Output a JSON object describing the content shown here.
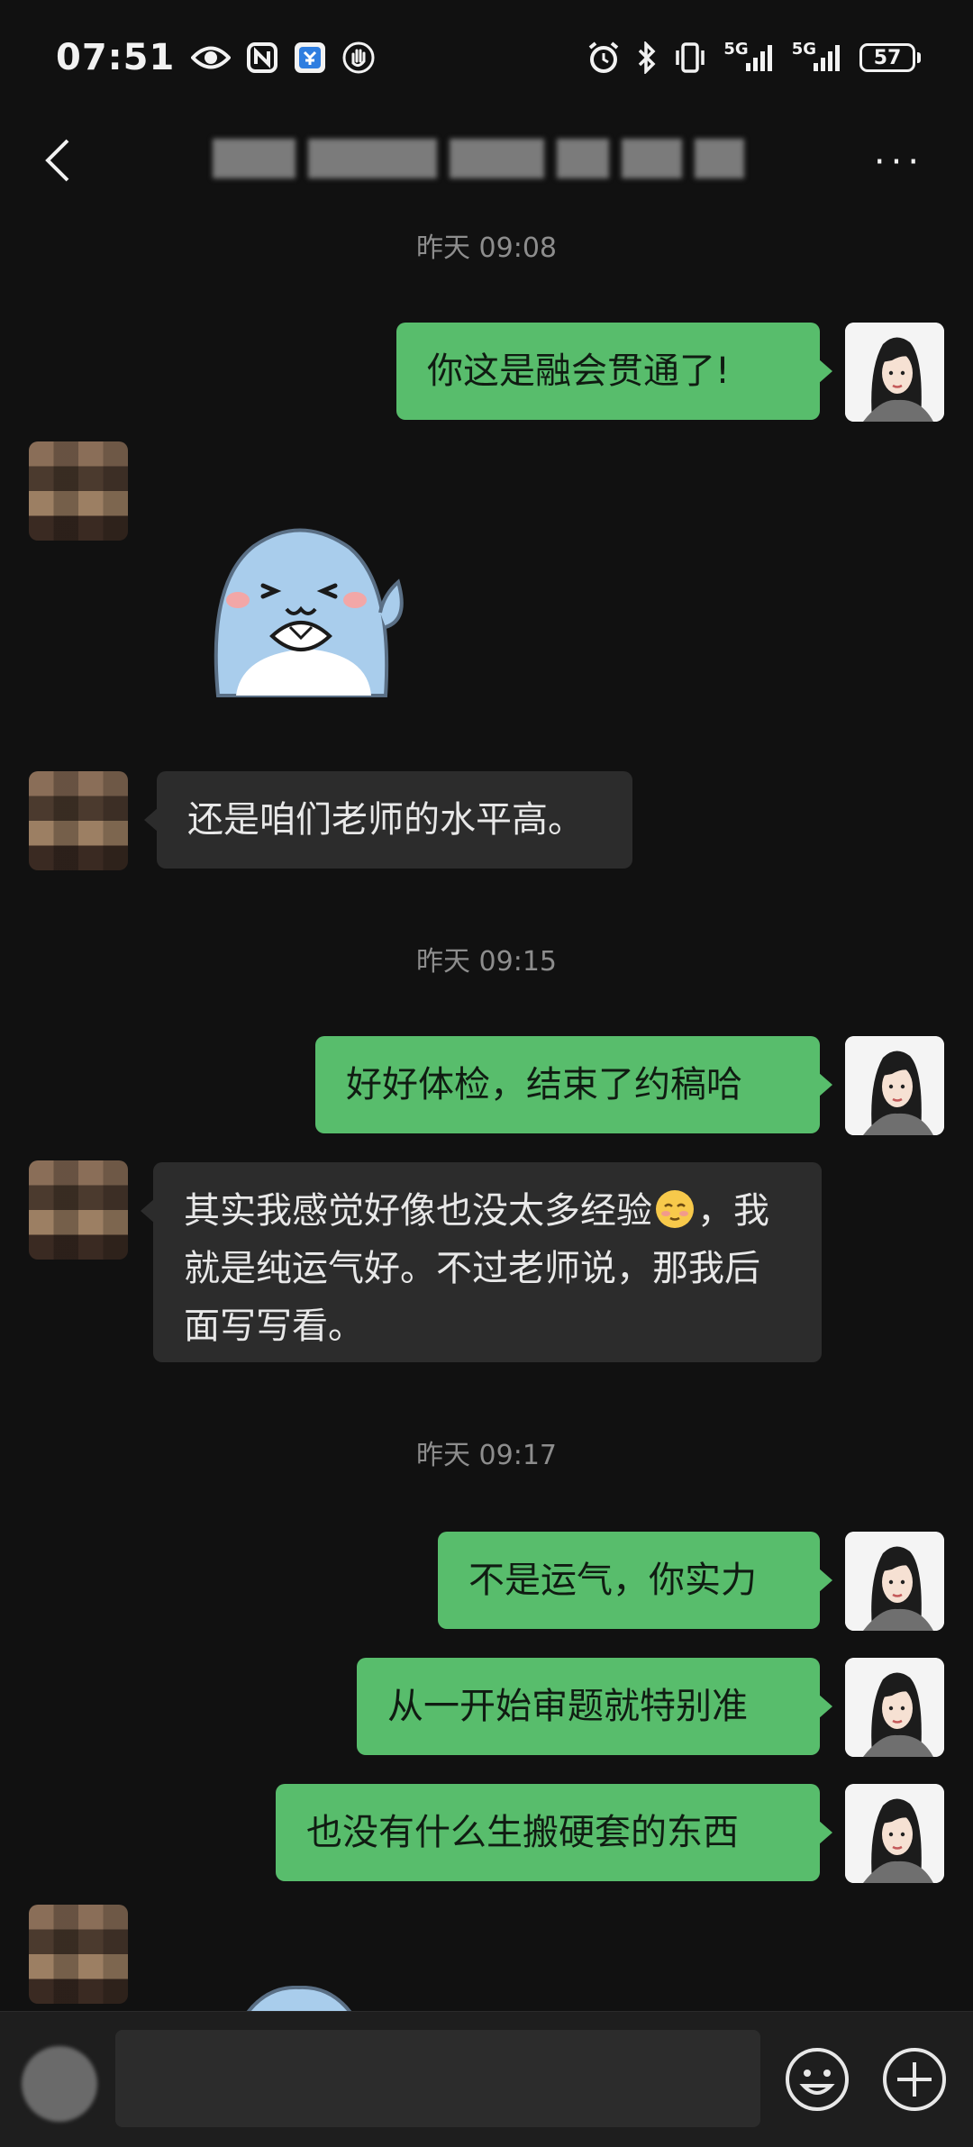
{
  "status_bar": {
    "time": "07:51",
    "battery": "57",
    "network_1": "5G",
    "network_2": "5G",
    "icons": [
      "eye-icon",
      "nfc-icon",
      "app-notification-icon",
      "hand-icon",
      "alarm-icon",
      "bluetooth-icon",
      "vibrate-icon",
      "signal-icon",
      "signal-icon",
      "battery-icon"
    ]
  },
  "header": {
    "back_icon": "chevron-left-icon",
    "more_label": "···"
  },
  "timestamps": [
    "昨天 09:08",
    "昨天 09:15",
    "昨天 09:17"
  ],
  "messages": [
    {
      "from": "self",
      "text": "你这是融会贯通了!"
    },
    {
      "from": "other",
      "type": "sticker",
      "sticker": "blue-dolphin-sticker"
    },
    {
      "from": "other",
      "text": "还是咱们老师的水平高。"
    },
    {
      "from": "self",
      "text": "好好体检，结束了约稿哈"
    },
    {
      "from": "other",
      "text_before_emoji": "其实我感觉好像也没太多经验",
      "emoji": "blush-emoji",
      "text_after_emoji": "，我就是纯运气好。不过老师说，那我后面写写看。"
    },
    {
      "from": "self",
      "text": "不是运气，你实力"
    },
    {
      "from": "self",
      "text": "从一开始审题就特别准"
    },
    {
      "from": "self",
      "text": "也没有什么生搬硬套的东西"
    }
  ],
  "input_bar": {
    "placeholder": "",
    "icons": [
      "voice-icon",
      "emoji-icon",
      "plus-icon"
    ]
  },
  "colors": {
    "background": "#111111",
    "self_bubble": "#58bd6c",
    "other_bubble": "#2c2c2c",
    "timestamp": "#8d8d8d"
  }
}
